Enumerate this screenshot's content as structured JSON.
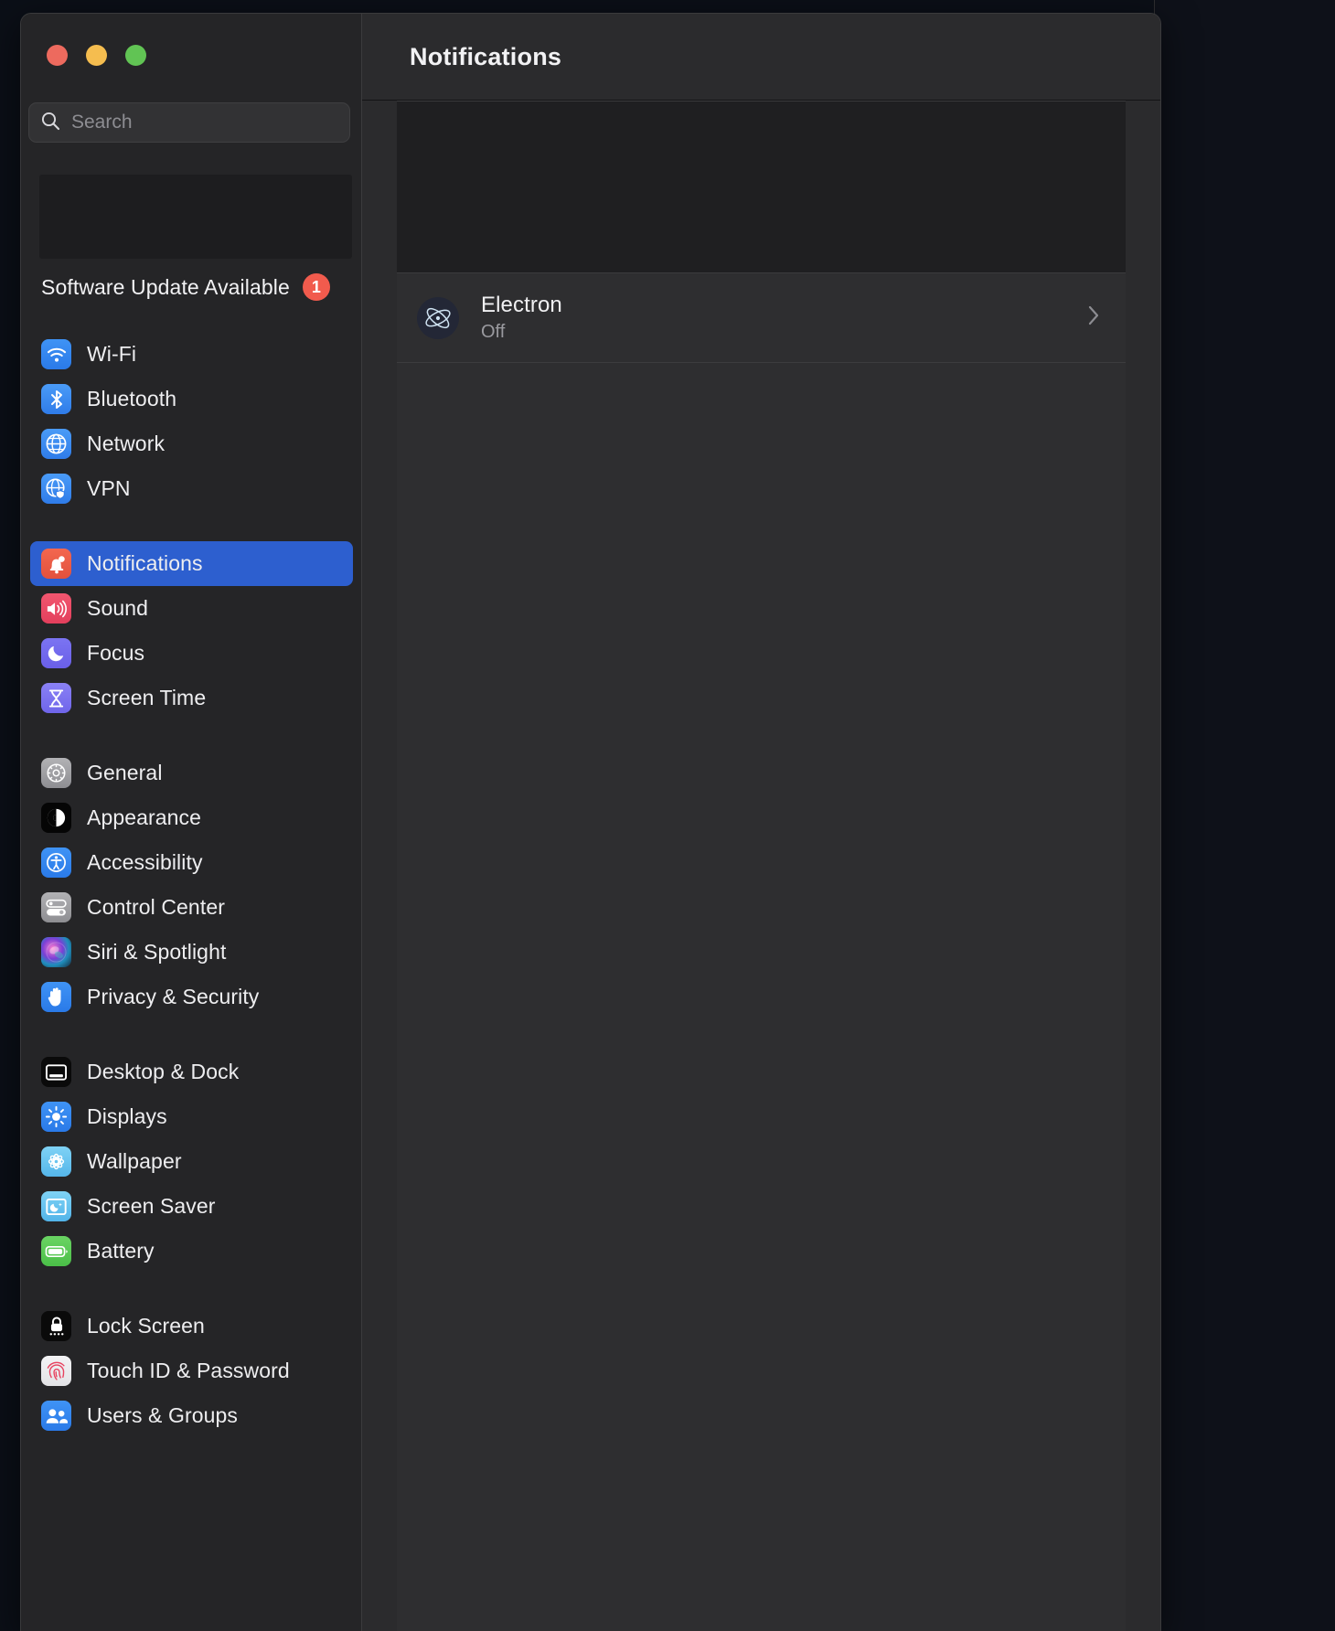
{
  "window": {
    "traffic_lights": [
      {
        "name": "close",
        "color": "#ed6a5e"
      },
      {
        "name": "minimize",
        "color": "#f5bd4f"
      },
      {
        "name": "maximize",
        "color": "#61c454"
      }
    ]
  },
  "sidebar": {
    "search": {
      "placeholder": "Search",
      "value": ""
    },
    "update": {
      "label": "Software Update Available",
      "badge": "1"
    },
    "groups": [
      {
        "items": [
          {
            "label": "Wi-Fi",
            "icon": "wifi-icon"
          },
          {
            "label": "Bluetooth",
            "icon": "bluetooth-icon"
          },
          {
            "label": "Network",
            "icon": "globe-icon"
          },
          {
            "label": "VPN",
            "icon": "globe-shield-icon"
          }
        ]
      },
      {
        "items": [
          {
            "label": "Notifications",
            "icon": "bell-icon",
            "selected": true
          },
          {
            "label": "Sound",
            "icon": "speaker-icon"
          },
          {
            "label": "Focus",
            "icon": "moon-icon"
          },
          {
            "label": "Screen Time",
            "icon": "hourglass-icon"
          }
        ]
      },
      {
        "items": [
          {
            "label": "General",
            "icon": "gear-icon"
          },
          {
            "label": "Appearance",
            "icon": "contrast-circle-icon"
          },
          {
            "label": "Accessibility",
            "icon": "accessibility-icon"
          },
          {
            "label": "Control Center",
            "icon": "sliders-icon"
          },
          {
            "label": "Siri & Spotlight",
            "icon": "siri-orb-icon"
          },
          {
            "label": "Privacy & Security",
            "icon": "hand-icon"
          }
        ]
      },
      {
        "items": [
          {
            "label": "Desktop & Dock",
            "icon": "desktop-dock-icon"
          },
          {
            "label": "Displays",
            "icon": "brightness-icon"
          },
          {
            "label": "Wallpaper",
            "icon": "flower-icon"
          },
          {
            "label": "Screen Saver",
            "icon": "screen-saver-icon"
          },
          {
            "label": "Battery",
            "icon": "battery-icon"
          }
        ]
      },
      {
        "items": [
          {
            "label": "Lock Screen",
            "icon": "lock-icon"
          },
          {
            "label": "Touch ID & Password",
            "icon": "fingerprint-icon"
          },
          {
            "label": "Users & Groups",
            "icon": "users-icon"
          }
        ]
      }
    ]
  },
  "main": {
    "title": "Notifications",
    "app_row": {
      "name": "Electron",
      "status": "Off",
      "icon": "electron-atom-icon",
      "chevron": "chevron-right-icon"
    }
  },
  "background": {
    "link_1": "n",
    "link_2": "a"
  },
  "colors": {
    "accent_selected": "#2d5fcf",
    "badge_red": "#f15b4d",
    "sidebar_bg": "#252527",
    "main_bg": "#2b2b2d",
    "panel_dark": "#1f1f21"
  }
}
